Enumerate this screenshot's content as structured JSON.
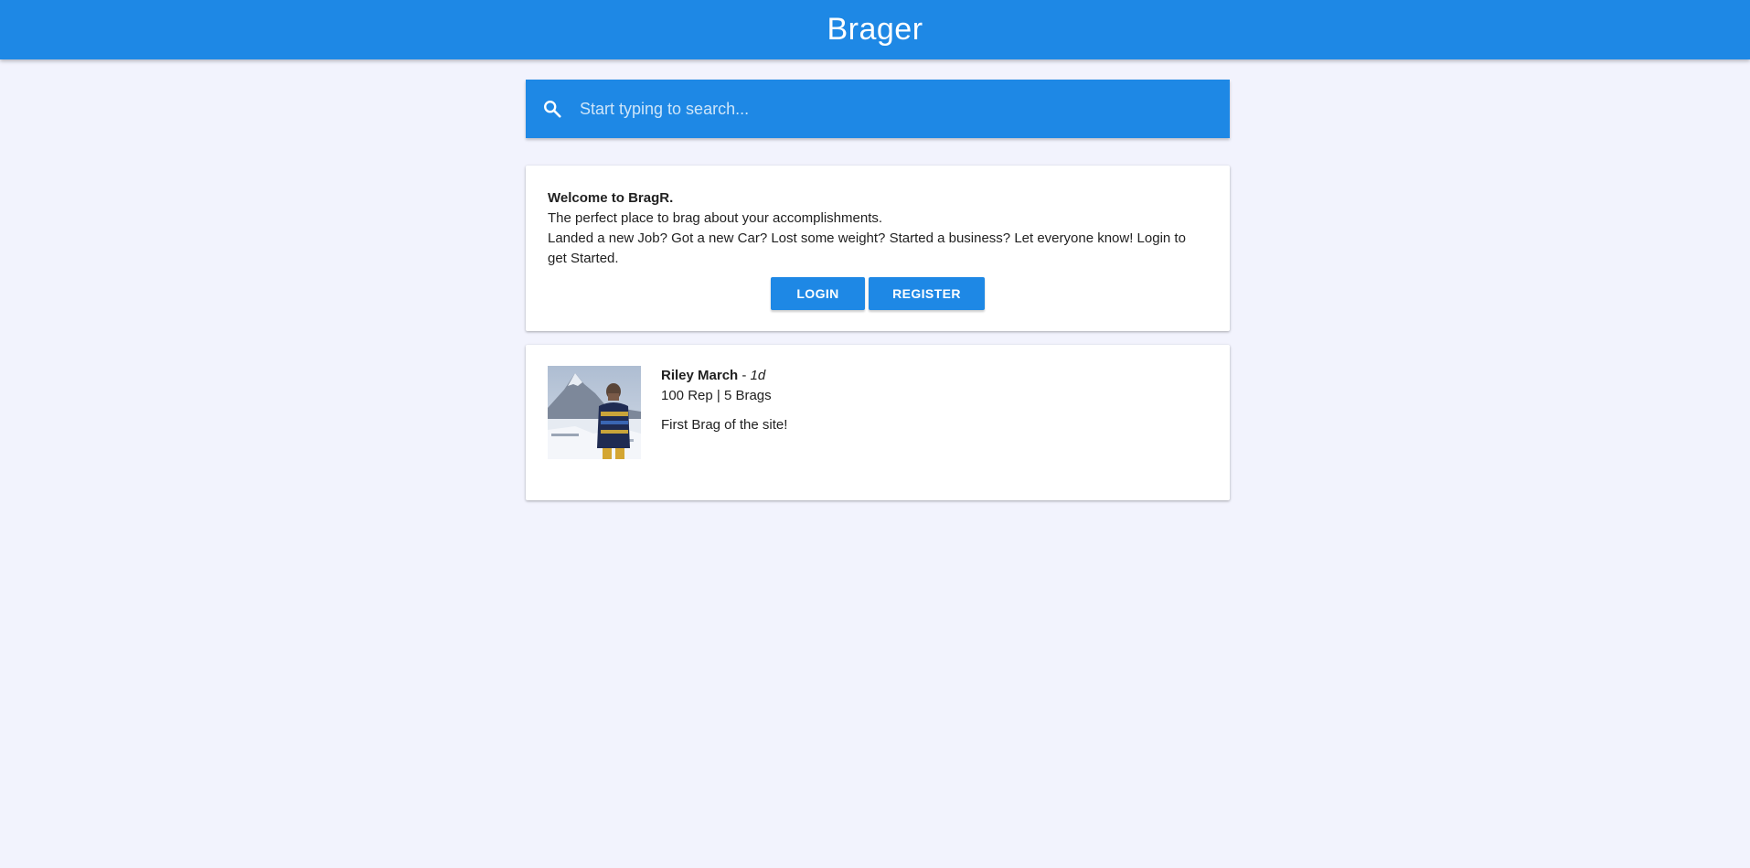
{
  "header": {
    "title": "Brager",
    "color": "#1e88e5"
  },
  "search": {
    "placeholder": "Start typing to search...",
    "value": "",
    "icon": "search-icon"
  },
  "welcome": {
    "heading": "Welcome to BragR.",
    "line1": "The perfect place to brag about your accomplishments.",
    "line2": "Landed a new Job? Got a new Car? Lost some weight? Started a business? Let everyone know! Login to get Started.",
    "login_label": "LOGIN",
    "register_label": "REGISTER"
  },
  "brags": [
    {
      "user": "Riley March",
      "separator": " - ",
      "time": "1d",
      "stats": "100 Rep | 5 Brags",
      "text": "First Brag of the site!"
    }
  ]
}
